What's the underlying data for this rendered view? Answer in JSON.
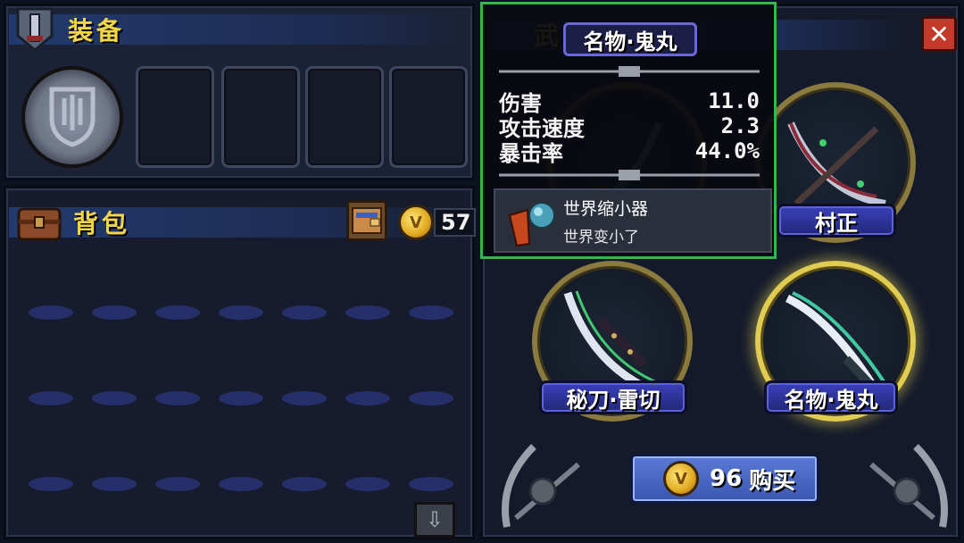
{
  "equipment": {
    "title": "装备",
    "icon": "helmet-icon",
    "shield_slot_icon": "shield-icon",
    "slot_count": 4
  },
  "backpack": {
    "title": "背包",
    "icon": "chest-icon",
    "bag_button_icon": "wallet-icon",
    "gold": "57",
    "coin_symbol": "V",
    "slot_rows": 3,
    "slot_cols": 7,
    "scroll_icon": "arrow-down-icon"
  },
  "shop": {
    "title_partial": "武",
    "close_icon": "close-icon",
    "weapons": [
      {
        "label": "",
        "icon": "crescent-blade-icon"
      },
      {
        "label": "村正",
        "icon": "muramasa-blade-icon"
      },
      {
        "label": "秘刀·雷切",
        "icon": "raikiri-blade-icon"
      },
      {
        "label": "名物·鬼丸",
        "icon": "onimaru-blade-icon",
        "selected": true
      }
    ],
    "buy": {
      "price": "96",
      "label": "购买",
      "coin_symbol": "V"
    }
  },
  "tooltip": {
    "name": "名物·鬼丸",
    "stats": [
      {
        "label": "伤害",
        "value": "11.0"
      },
      {
        "label": "攻击速度",
        "value": "2.3"
      },
      {
        "label": "暴击率",
        "value": "44.0%"
      }
    ],
    "effect": {
      "name": "世界缩小器",
      "desc": "世界变小了",
      "icon": "shrink-device-icon"
    }
  },
  "colors": {
    "title_gold": "#f2d64a",
    "label_blue": "#3a40b8",
    "tooltip_border": "#35b84a",
    "close_red": "#c43a2a"
  }
}
